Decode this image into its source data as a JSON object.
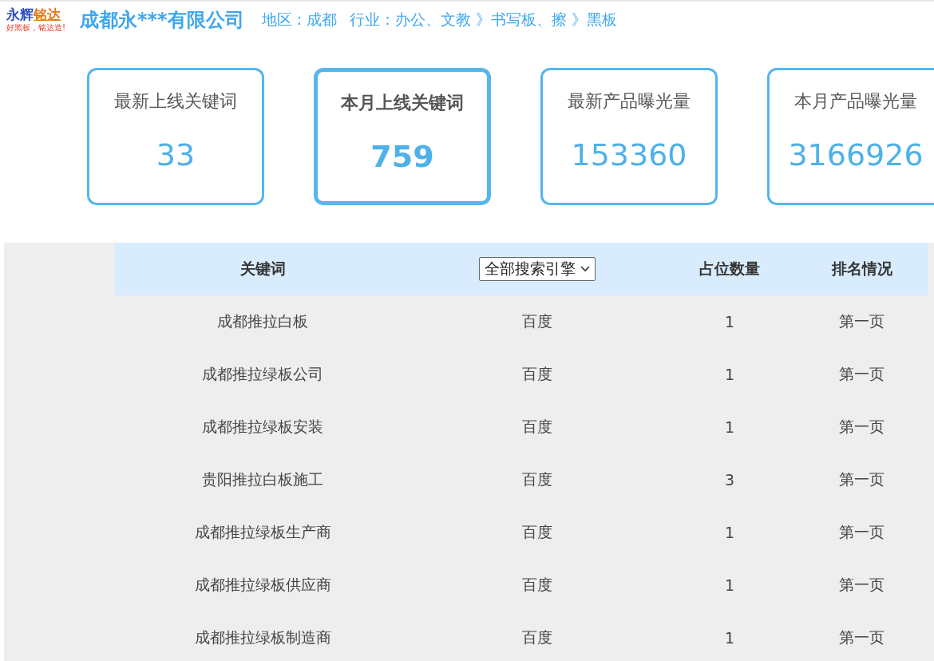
{
  "logo": {
    "name_primary": "永辉",
    "name_secondary": "铭达",
    "slogan": "好黑板，铭达造!"
  },
  "company": {
    "name": "成都永***有限公司",
    "region": "地区 : 成都",
    "industry": "行业 : 办公、文教 》书写板、擦 》黑板"
  },
  "stats": [
    {
      "label": "最新上线关键词",
      "value": "33",
      "selected": false
    },
    {
      "label": "本月上线关键词",
      "value": "759",
      "selected": true
    },
    {
      "label": "最新产品曝光量",
      "value": "153360",
      "selected": false
    },
    {
      "label": "本月产品曝光量",
      "value": "3166926",
      "selected": false
    }
  ],
  "table": {
    "columns": [
      {
        "kind": "text",
        "label": "关键词"
      },
      {
        "kind": "dropdown",
        "value": "全部搜索引擎"
      },
      {
        "kind": "text",
        "label": "占位数量"
      },
      {
        "kind": "text",
        "label": "排名情况"
      }
    ],
    "rows": [
      [
        "成都推拉白板",
        "百度",
        "1",
        "第一页"
      ],
      [
        "成都推拉绿板公司",
        "百度",
        "1",
        "第一页"
      ],
      [
        "成都推拉绿板安装",
        "百度",
        "1",
        "第一页"
      ],
      [
        "贵阳推拉白板施工",
        "百度",
        "3",
        "第一页"
      ],
      [
        "成都推拉绿板生产商",
        "百度",
        "1",
        "第一页"
      ],
      [
        "成都推拉绿板供应商",
        "百度",
        "1",
        "第一页"
      ],
      [
        "成都推拉绿板制造商",
        "百度",
        "1",
        "第一页"
      ]
    ]
  }
}
